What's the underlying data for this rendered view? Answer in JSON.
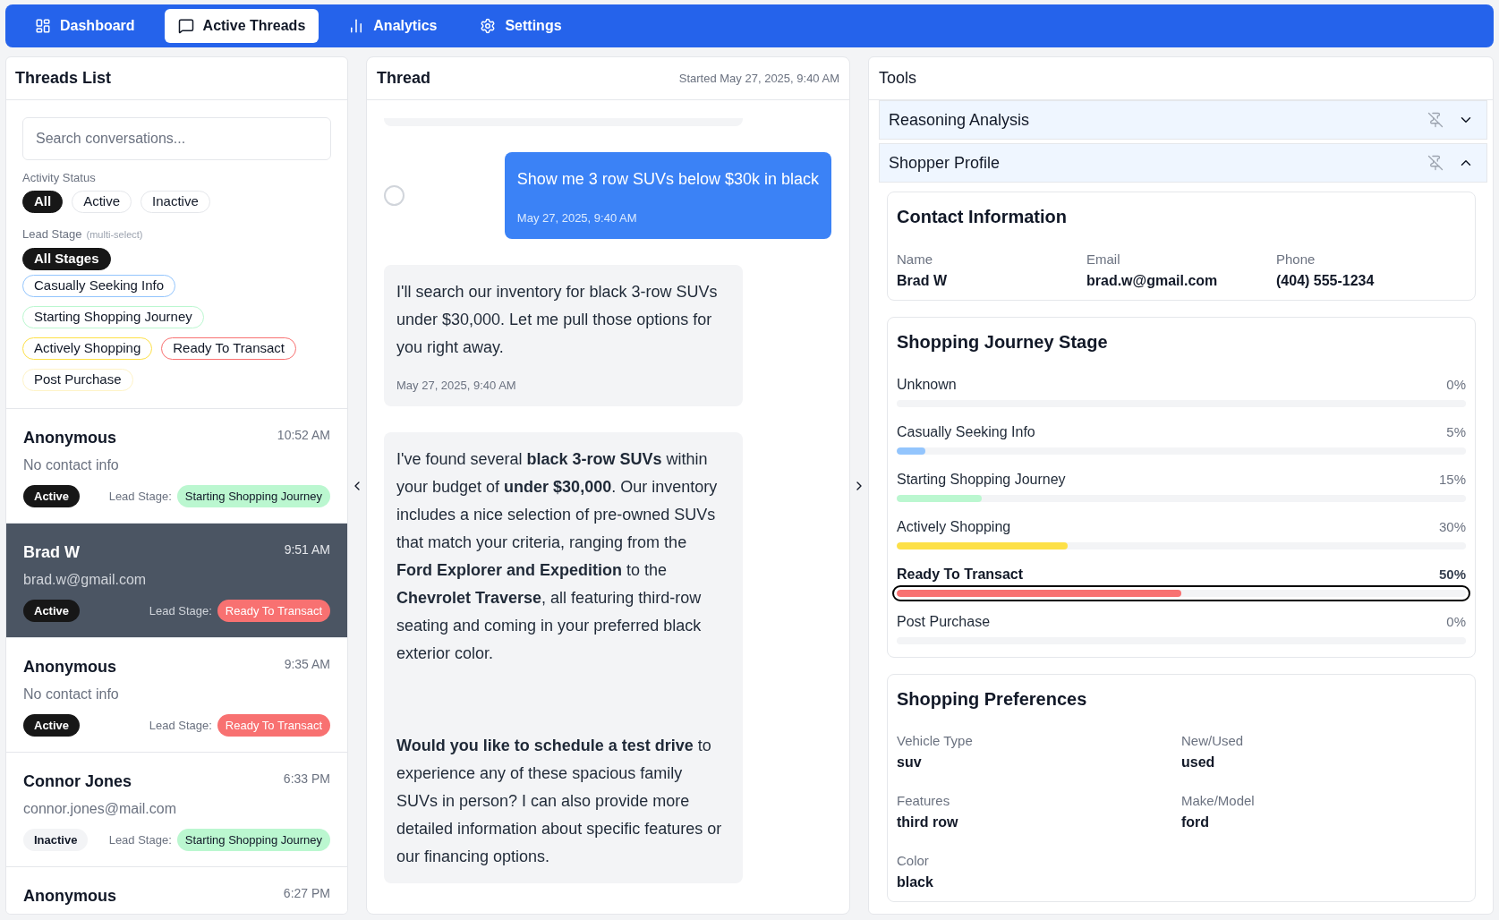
{
  "nav": {
    "tabs": [
      {
        "label": "Dashboard",
        "selected": false
      },
      {
        "label": "Active Threads",
        "selected": true
      },
      {
        "label": "Analytics",
        "selected": false
      },
      {
        "label": "Settings",
        "selected": false
      }
    ]
  },
  "threads_list": {
    "title": "Threads List",
    "search": {
      "placeholder": "Search conversations..."
    },
    "activity_filter": {
      "label": "Activity Status",
      "options": [
        {
          "label": "All",
          "selected": true
        },
        {
          "label": "Active",
          "selected": false
        },
        {
          "label": "Inactive",
          "selected": false
        }
      ]
    },
    "stage_filter": {
      "label": "Lead Stage",
      "hint": "(multi-select)",
      "options": [
        {
          "label": "All Stages",
          "selected": true
        },
        {
          "label": "Casually Seeking Info",
          "selected": false,
          "color": "#93c5fd"
        },
        {
          "label": "Starting Shopping Journey",
          "selected": false,
          "color": "#bbf7d0"
        },
        {
          "label": "Actively Shopping",
          "selected": false,
          "color": "#fde047"
        },
        {
          "label": "Ready To Transact",
          "selected": false,
          "color": "#f87171"
        },
        {
          "label": "Post Purchase",
          "selected": false,
          "color": "#fef3c7"
        }
      ]
    },
    "threads": [
      {
        "name": "Anonymous",
        "time": "10:52 AM",
        "contact": "No contact info",
        "status": "Active",
        "active": true,
        "stage_label": "Lead Stage:",
        "stage": "Starting Shopping Journey",
        "color": "#bbf7d0",
        "selected": false
      },
      {
        "name": "Brad W",
        "time": "9:51 AM",
        "contact": "brad.w@gmail.com",
        "status": "Active",
        "active": true,
        "stage_label": "Lead Stage:",
        "stage": "Ready To Transact",
        "color": "#f87171",
        "selected": true
      },
      {
        "name": "Anonymous",
        "time": "9:35 AM",
        "contact": "No contact info",
        "status": "Active",
        "active": true,
        "stage_label": "Lead Stage:",
        "stage": "Ready To Transact",
        "color": "#f87171",
        "selected": false
      },
      {
        "name": "Connor Jones",
        "time": "6:33 PM",
        "contact": "connor.jones@mail.com",
        "status": "Inactive",
        "active": false,
        "stage_label": "Lead Stage:",
        "stage": "Starting Shopping Journey",
        "color": "#bbf7d0",
        "selected": false
      },
      {
        "name": "Anonymous",
        "time": "6:27 PM",
        "selected": false
      }
    ]
  },
  "thread": {
    "title": "Thread",
    "started": "Started May 27, 2025, 9:40 AM",
    "messages": [
      {
        "kind": "user",
        "text": "Show me 3 row SUVs below $30k in black",
        "time": "May 27, 2025, 9:40 AM",
        "selected": false
      },
      {
        "kind": "assistant",
        "paragraphs": [
          "I'll search our inventory for black 3-row SUVs under $30,000. Let me pull those options for you right away."
        ],
        "time": "May 27, 2025, 9:40 AM"
      },
      {
        "kind": "assistant",
        "paragraphs": [
          "I've found several **black 3-row SUVs** within your budget of **under $30,000**. Our inventory includes a nice selection of pre-owned SUVs that match your criteria, ranging from the **Ford Explorer and Expedition** to the **Chevrolet Traverse**, all featuring third-row seating and coming in your preferred black exterior color.",
          "**Would you like to schedule a test drive** to experience any of these spacious family SUVs in person? I can also provide more detailed information about specific features or our financing options."
        ]
      }
    ]
  },
  "tools": {
    "title": "Tools",
    "sections": [
      {
        "title": "Reasoning Analysis",
        "pinned": false,
        "expanded": false
      },
      {
        "title": "Shopper Profile",
        "pinned": false,
        "expanded": true,
        "contact": {
          "title": "Contact Information",
          "fields": [
            {
              "label": "Name",
              "value": "Brad W"
            },
            {
              "label": "Email",
              "value": "brad.w@gmail.com"
            },
            {
              "label": "Phone",
              "value": "(404) 555-1234"
            }
          ]
        },
        "journey": {
          "title": "Shopping Journey Stage",
          "stages": [
            {
              "label": "Unknown",
              "reading": "0%",
              "selected": false
            },
            {
              "label": "Casually Seeking Info",
              "reading": "5%",
              "level": 0.05,
              "color": "#93c5fd",
              "selected": false
            },
            {
              "label": "Starting Shopping Journey",
              "reading": "15%",
              "level": 0.15,
              "color": "#bbf7d0",
              "selected": false
            },
            {
              "label": "Actively Shopping",
              "reading": "30%",
              "level": 0.3,
              "color": "#fde047",
              "selected": false
            },
            {
              "label": "Ready To Transact",
              "reading": "50%",
              "level": 0.5,
              "color": "#f87171",
              "selected": true
            },
            {
              "label": "Post Purchase",
              "reading": "0%",
              "selected": false
            }
          ]
        },
        "preferences": {
          "title": "Shopping Preferences",
          "fields": [
            {
              "label": "Vehicle Type",
              "value": "suv"
            },
            {
              "label": "New/Used",
              "value": "used"
            },
            {
              "label": "Features",
              "value": "third row"
            },
            {
              "label": "Make/Model",
              "value": "ford"
            },
            {
              "label": "Color",
              "value": "black"
            }
          ]
        }
      }
    ]
  }
}
